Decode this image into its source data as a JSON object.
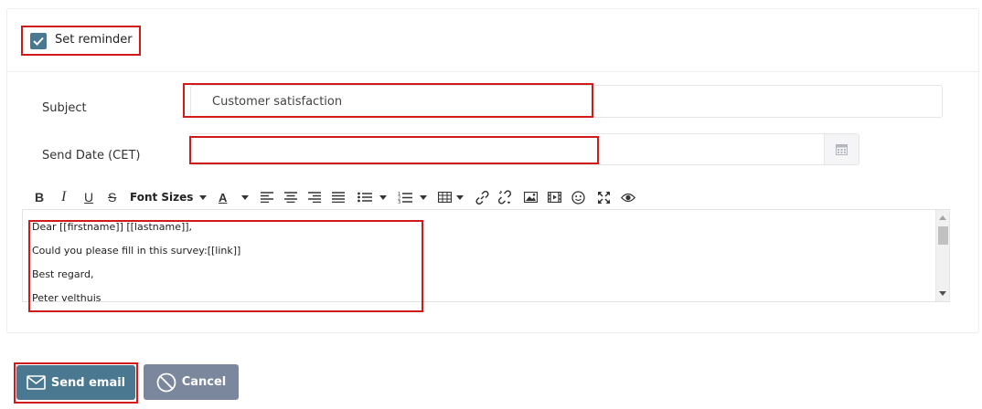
{
  "reminder": {
    "label": "Set reminder",
    "checked": true
  },
  "form": {
    "subject_label": "Subject",
    "subject_value": "Customer satisfaction",
    "send_date_label": "Send Date (CET)",
    "send_date_value": ""
  },
  "toolbar": {
    "font_sizes_label": "Font Sizes",
    "icons": [
      "bold-icon",
      "italic-icon",
      "underline-icon",
      "strikethrough-icon",
      "font-sizes-dropdown",
      "font-color-icon",
      "align-left-icon",
      "align-center-icon",
      "align-right-icon",
      "align-justify-icon",
      "bulleted-list-icon",
      "numbered-list-icon",
      "table-icon",
      "link-icon",
      "unlink-icon",
      "image-icon",
      "video-icon",
      "emoji-icon",
      "fullscreen-icon",
      "preview-icon"
    ],
    "bold_glyph": "B",
    "italic_glyph": "I",
    "underline_glyph": "U",
    "strike_glyph": "S",
    "color_glyph": "A"
  },
  "editor": {
    "lines": [
      "Dear [[firstname]] [[lastname]],",
      "Could you please fill in this survey:[[link]]",
      "Best regard,",
      "Peter velthuis"
    ]
  },
  "actions": {
    "send_label": "Send email",
    "cancel_label": "Cancel"
  },
  "colors": {
    "primary": "#4a7891",
    "secondary": "#7b879c",
    "highlight": "#d11b1b"
  }
}
